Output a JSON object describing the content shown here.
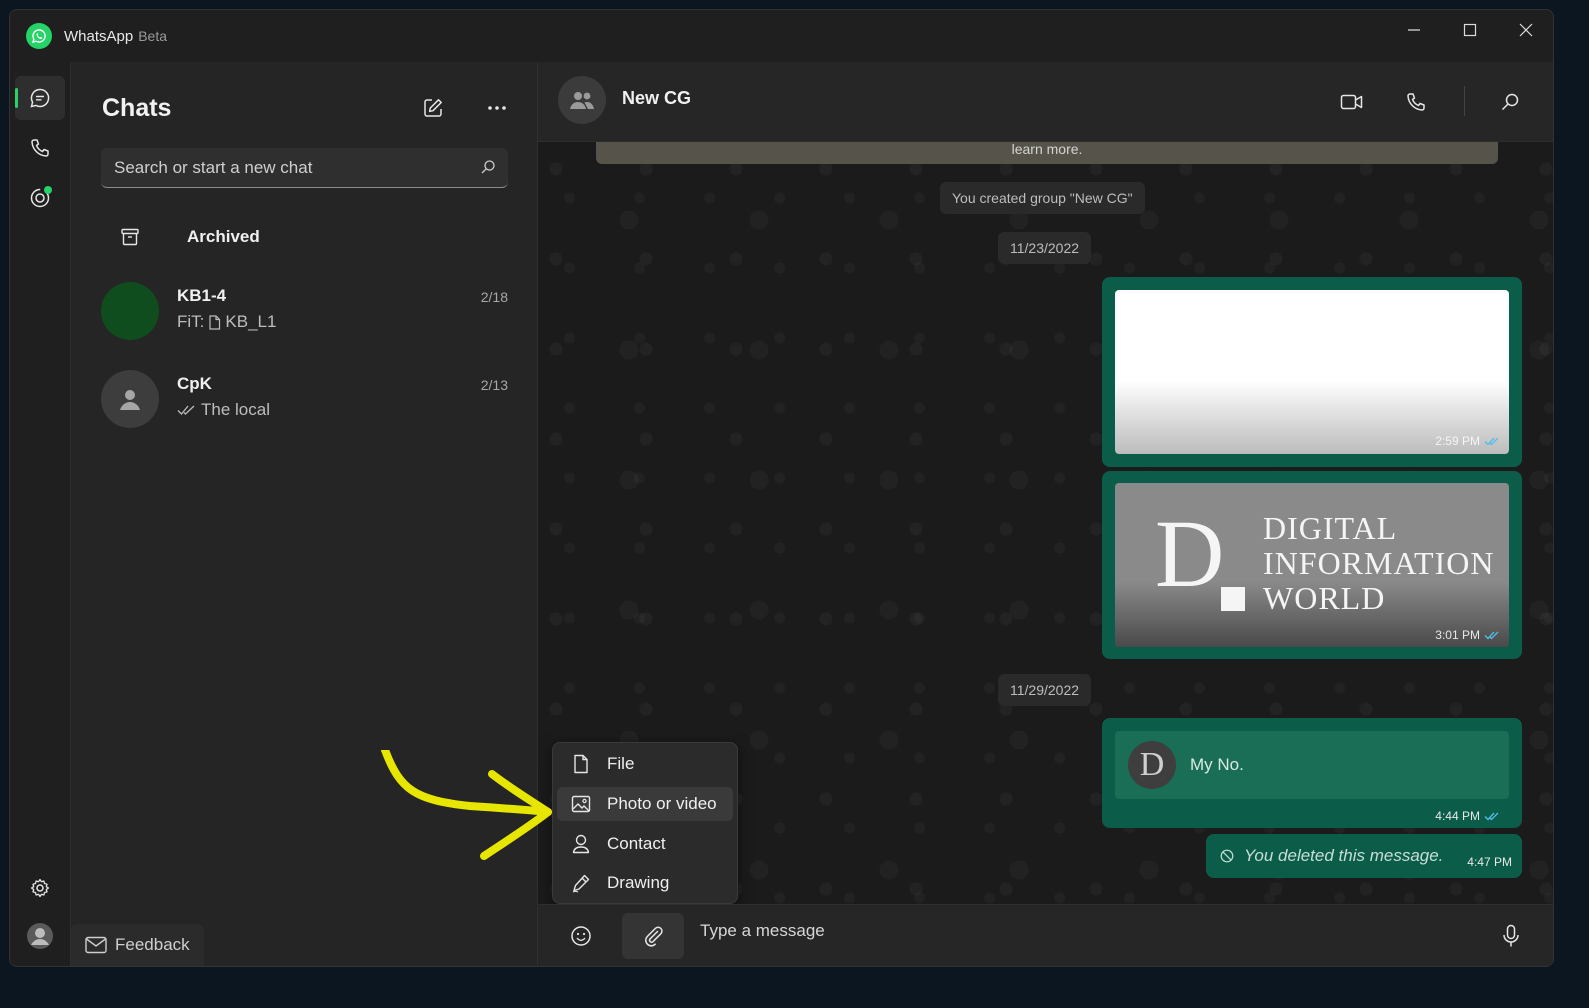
{
  "window": {
    "app_name": "WhatsApp",
    "app_badge": "Beta"
  },
  "sidebar": {
    "title": "Chats",
    "search_placeholder": "Search or start a new chat",
    "archived_label": "Archived",
    "chats": [
      {
        "name": "KB1-4",
        "date": "2/18",
        "preview_prefix": "FiT:",
        "preview_text": "KB_L1",
        "avatar_color": "#0f4d1e"
      },
      {
        "name": "CpK",
        "date": "2/13",
        "preview_text": "The local",
        "avatar_color": "#3d3d3d"
      }
    ],
    "feedback_label": "Feedback"
  },
  "chat": {
    "name": "New CG",
    "notice_text": "learn more.",
    "system_message": "You created group \"New CG\"",
    "date_1": "11/23/2022",
    "date_2": "11/29/2022",
    "messages": [
      {
        "type": "image",
        "time": "2:59 PM"
      },
      {
        "type": "image",
        "time": "3:01 PM",
        "logo_letter": "D",
        "logo_lines": [
          "DIGITAL",
          "INFORMATION",
          "WORLD"
        ]
      },
      {
        "type": "contact",
        "time": "4:44 PM",
        "contact_initial": "D",
        "contact_name": "My No."
      },
      {
        "type": "deleted",
        "time": "4:47 PM",
        "text": "You deleted this message."
      }
    ]
  },
  "attach_menu": {
    "items": [
      {
        "label": "File",
        "icon": "file-icon"
      },
      {
        "label": "Photo or video",
        "icon": "image-icon"
      },
      {
        "label": "Contact",
        "icon": "person-icon"
      },
      {
        "label": "Drawing",
        "icon": "pen-icon"
      }
    ]
  },
  "composer": {
    "placeholder": "Type a message"
  },
  "colors": {
    "accent": "#25d366",
    "outgoing_bubble": "#0b5d4a",
    "read_ticks": "#53bdeb",
    "annotation_arrow": "#e6e600"
  }
}
